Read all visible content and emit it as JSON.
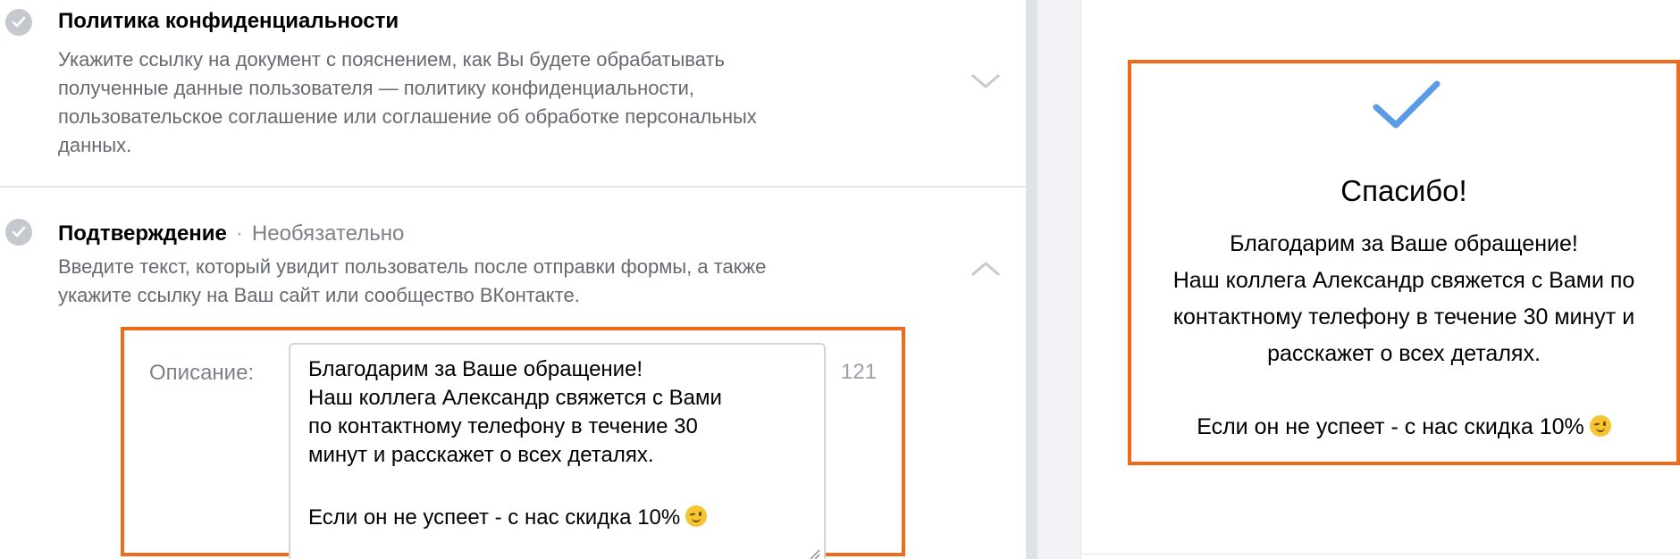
{
  "privacy": {
    "title": "Политика конфиденциальности",
    "desc": [
      "Укажите ссылку на документ с пояснением, как Вы будете обрабатывать",
      "полученные данные пользователя — политику конфиденциальности,",
      "пользовательское соглашение или соглашение об обработке персональных",
      "данных."
    ]
  },
  "confirmation": {
    "title": "Подтверждение",
    "separator": "·",
    "optional": "Необязательно",
    "desc": [
      "Введите текст, который увидит пользователь после отправки формы, а также",
      "укажите ссылку на Ваш сайт или сообщество ВКонтакте."
    ],
    "editor": {
      "label": "Описание:",
      "lines": [
        "Благодарим за Ваше обращение!",
        "Наш коллега Александр свяжется с Вами",
        "по контактному телефону в течение 30",
        "минут и расскажет о всех деталях."
      ],
      "last_line": "Если он не успеет - с нас скидка 10%",
      "char_count": "121"
    }
  },
  "preview": {
    "title": "Спасибо!",
    "lines": [
      "Благодарим за Ваше обращение!",
      "Наш коллега Александр свяжется с Вами по",
      "контактному телефону в течение 30 минут и",
      "расскажет о всех деталях."
    ],
    "last_line": "Если он не успеет - с нас скидка 10%"
  },
  "colors": {
    "highlight": "#f06a1c",
    "check_blue": "#5181b8",
    "check_gray": "#c5c8cd"
  },
  "icons": {
    "section_check": "check-circle-icon",
    "collapse": "chevron-down-icon",
    "expand": "chevron-up-icon",
    "success": "checkmark-icon",
    "emoji": "winking-face-emoji"
  }
}
